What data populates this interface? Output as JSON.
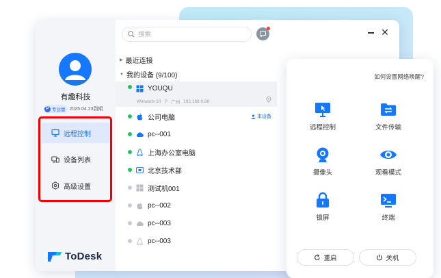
{
  "colors": {
    "accent": "#1677ff",
    "online": "#22c55e",
    "offline": "#c8ccd2",
    "highlight_box": "#f10000"
  },
  "sidebar": {
    "username": "有趣科技",
    "plan_badge": "专业版",
    "expiry": "2025.04.23到期",
    "nav": [
      {
        "label": "远程控制",
        "icon": "monitor-icon",
        "active": true
      },
      {
        "label": "设备列表",
        "icon": "devices-icon",
        "active": false
      },
      {
        "label": "高级设置",
        "icon": "settings-icon",
        "active": false
      }
    ],
    "logo_text": "ToDesk"
  },
  "search": {
    "placeholder": "搜索"
  },
  "devices": {
    "recent_label": "最近连接",
    "mine_label": "我的设备 (9/100)",
    "selected_sub": {
      "os": "Winwods 10",
      "location": "广州",
      "ip": "192.168.0.88"
    },
    "this_device_label": "本设备",
    "items": [
      {
        "name": "YOUQU",
        "online": true,
        "os": "windows-icon"
      },
      {
        "name": "公司电脑",
        "online": true,
        "os": "apple-icon"
      },
      {
        "name": "pc--001",
        "online": true,
        "os": "cloud-icon"
      },
      {
        "name": "上海办公室电脑",
        "online": true,
        "os": "linux-icon"
      },
      {
        "name": "北京技术部",
        "online": true,
        "os": "display-icon"
      },
      {
        "name": "测试机001",
        "online": false,
        "os": "windows-icon"
      },
      {
        "name": "pc--002",
        "online": false,
        "os": "apple-icon"
      },
      {
        "name": "pc--003",
        "online": false,
        "os": "cloud-icon"
      },
      {
        "name": "pc--003",
        "online": false,
        "os": "linux-icon"
      }
    ]
  },
  "panel": {
    "wake_link": "如何设置网络唤醒?",
    "functions": [
      {
        "label": "远程控制",
        "icon": "remote-control-icon"
      },
      {
        "label": "文件传输",
        "icon": "file-transfer-icon"
      },
      {
        "label": "摄像头",
        "icon": "camera-icon"
      },
      {
        "label": "观看模式",
        "icon": "eye-icon"
      },
      {
        "label": "锁屏",
        "icon": "lock-icon"
      },
      {
        "label": "终端",
        "icon": "terminal-icon"
      }
    ],
    "restart_label": "重启",
    "shutdown_label": "关机"
  }
}
